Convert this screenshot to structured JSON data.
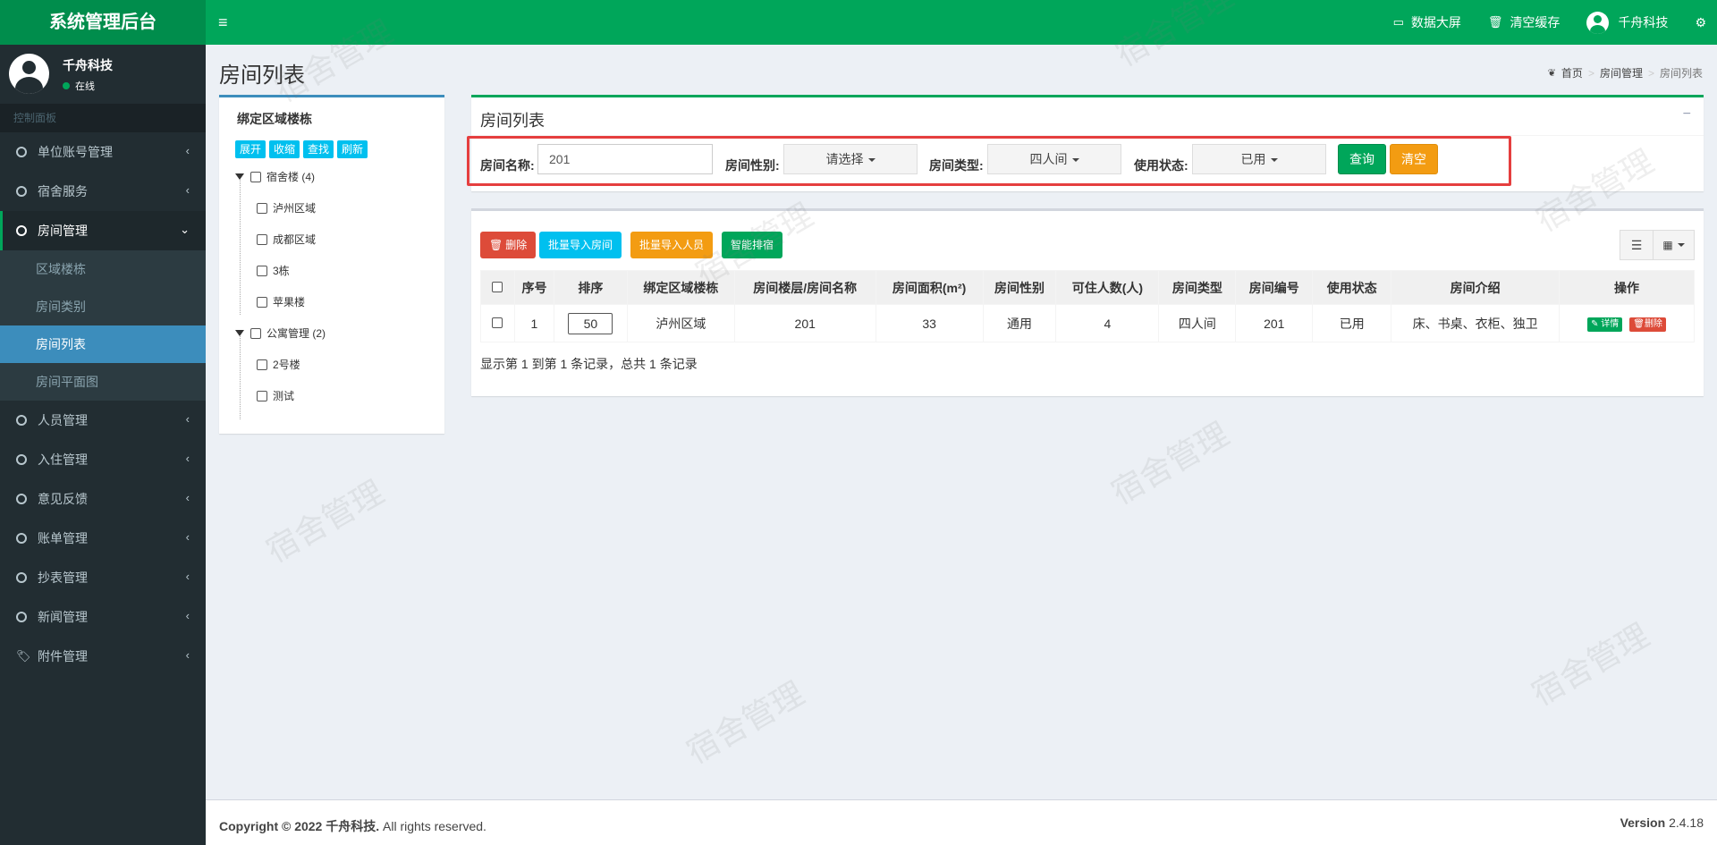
{
  "app": {
    "title": "系统管理后台",
    "menu_icon": "bars-icon",
    "header": {
      "data_screen": "数据大屏",
      "clear_cache": "清空缓存",
      "user_name": "千舟科技"
    }
  },
  "sidebar": {
    "user_name": "千舟科技",
    "status": "在线",
    "section": "控制面板",
    "items": [
      {
        "label": "单位账号管理"
      },
      {
        "label": "宿舍服务"
      },
      {
        "label": "房间管理",
        "sub": [
          {
            "label": "区域楼栋"
          },
          {
            "label": "房间类别"
          },
          {
            "label": "房间列表"
          },
          {
            "label": "房间平面图"
          }
        ]
      },
      {
        "label": "人员管理"
      },
      {
        "label": "入住管理"
      },
      {
        "label": "意见反馈"
      },
      {
        "label": "账单管理"
      },
      {
        "label": "抄表管理"
      },
      {
        "label": "新闻管理"
      },
      {
        "label": "附件管理"
      }
    ]
  },
  "page": {
    "title": "房间列表",
    "breadcrumb": [
      "首页",
      "房间管理",
      "房间列表"
    ]
  },
  "tree": {
    "title": "绑定区域楼栋",
    "buttons": [
      "展开",
      "收缩",
      "查找",
      "刷新"
    ],
    "groups": [
      {
        "label": "宿舍楼 (4)",
        "children": [
          "泸州区域",
          "成都区域",
          "3栋",
          "苹果楼"
        ]
      },
      {
        "label": "公寓管理 (2)",
        "children": [
          "2号楼",
          "测试"
        ]
      }
    ]
  },
  "search": {
    "title": "房间列表",
    "room_name_label": "房间名称:",
    "room_name_value": "201",
    "gender_label": "房间性别:",
    "gender_value": "请选择",
    "type_label": "房间类型:",
    "type_value": "四人间",
    "status_label": "使用状态:",
    "status_value": "已用",
    "query": "查询",
    "clear": "清空"
  },
  "toolbar": {
    "delete": "删除",
    "import_rooms": "批量导入房间",
    "import_people": "批量导入人员",
    "smart_assign": "智能排宿"
  },
  "table": {
    "columns": [
      "序号",
      "排序",
      "绑定区域楼栋",
      "房间楼层/房间名称",
      "房间面积(m²)",
      "房间性别",
      "可住人数(人)",
      "房间类型",
      "房间编号",
      "使用状态",
      "房间介绍",
      "操作"
    ],
    "rows": [
      {
        "index": "1",
        "sort": "50",
        "area": "泸州区域",
        "name": "201",
        "size": "33",
        "gender": "通用",
        "capacity": "4",
        "type": "四人间",
        "code": "201",
        "status": "已用",
        "intro": "床、书桌、衣柜、独卫",
        "detail": "详情",
        "delete": "删除"
      }
    ],
    "pager": "显示第 1 到第 1 条记录，总共 1 条记录"
  },
  "footer": {
    "copyright_prefix": "Copyright © 2022",
    "company": "千舟科技.",
    "rights": "All rights reserved.",
    "version_label": "Version",
    "version": "2.4.18"
  },
  "watermark": "宿舍管理",
  "colors": {
    "primary": "#00a65a",
    "sidebar": "#222d32",
    "active_sub": "#3c8dbc",
    "danger": "#dd4b39",
    "info": "#00c0ef",
    "warning": "#f39c12"
  }
}
